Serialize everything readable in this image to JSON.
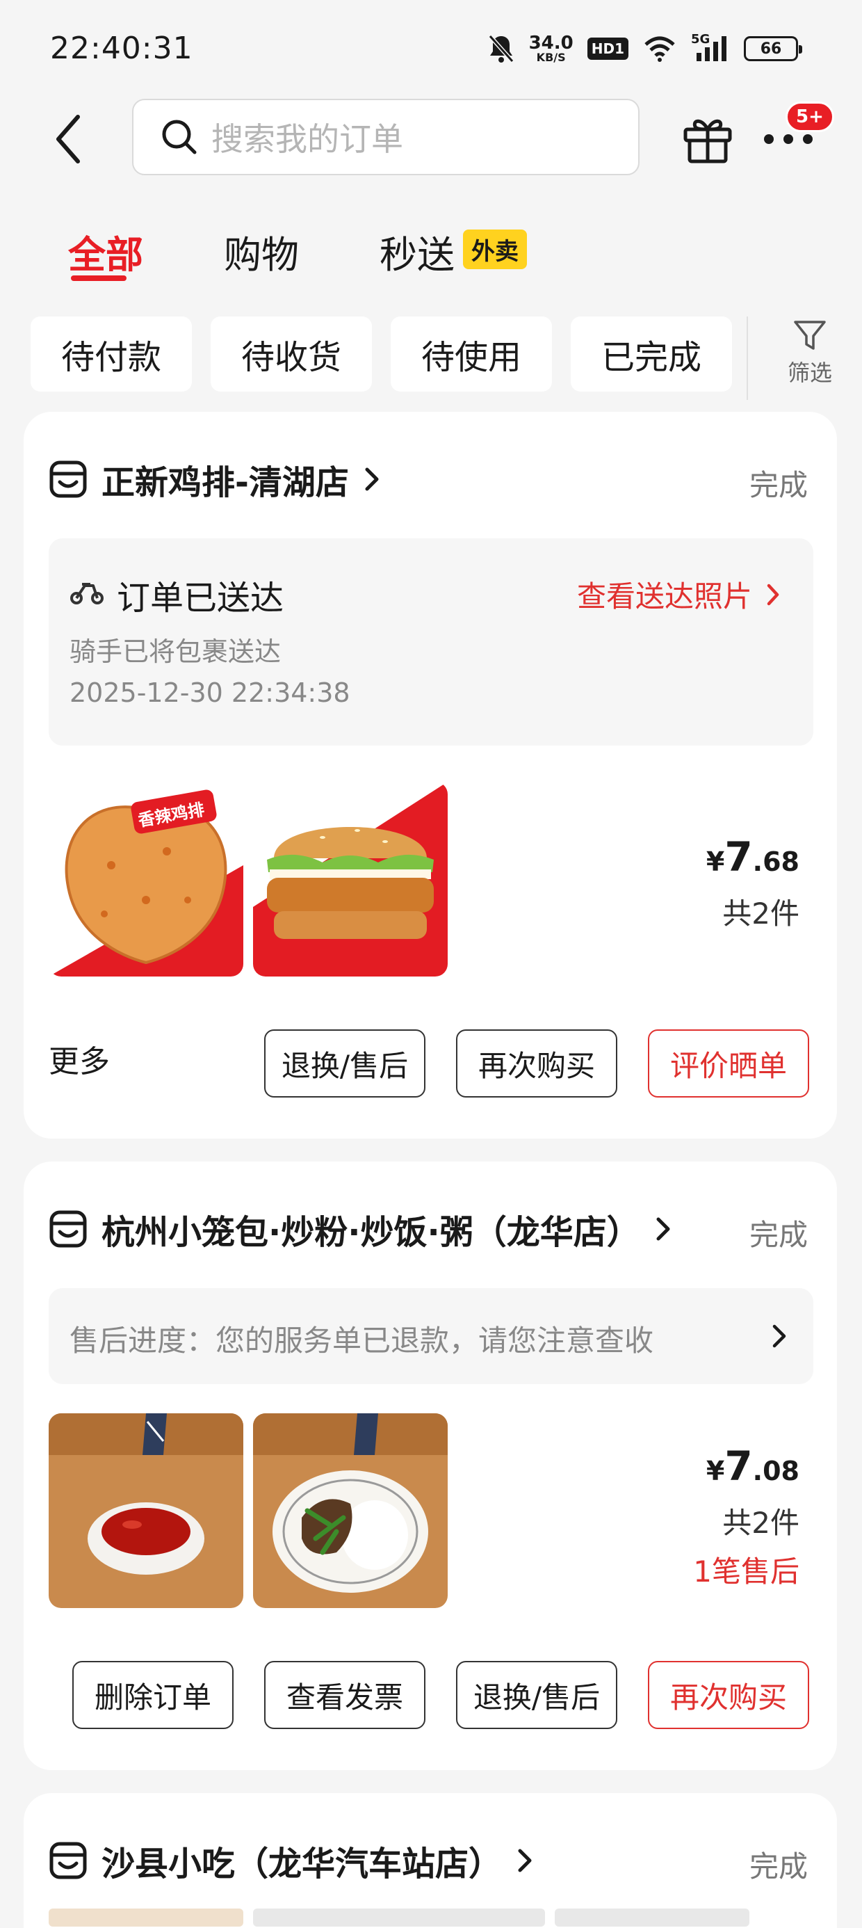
{
  "status_bar": {
    "time": "22:40:31",
    "net_speed": "34.0",
    "net_unit": "KB/S",
    "hd_label": "HD1",
    "signal_label": "5G",
    "battery": "66"
  },
  "header": {
    "search_placeholder": "搜索我的订单",
    "badge": "5+"
  },
  "tabs": [
    {
      "label": "全部",
      "active": true
    },
    {
      "label": "购物",
      "active": false
    },
    {
      "label": "秒送",
      "active": false,
      "tag": "外卖"
    }
  ],
  "filters": {
    "chips": [
      "待付款",
      "待收货",
      "待使用",
      "已完成"
    ],
    "filter_label": "筛选"
  },
  "orders": [
    {
      "shop_name": "正新鸡排-清湖店",
      "status": "完成",
      "delivery": {
        "title": "订单已送达",
        "photo_link": "查看送达照片",
        "sub": "骑手已将包裹送达",
        "time": "2025-12-30 22:34:38"
      },
      "img_tag": "香辣鸡排",
      "price_currency": "¥",
      "price_int": "7",
      "price_dec": ".68",
      "count": "共2件",
      "more": "更多",
      "buttons": [
        "退换/售后",
        "再次购买",
        "评价晒单"
      ]
    },
    {
      "shop_name": "杭州小笼包·炒粉·炒饭·粥（龙华店）",
      "status": "完成",
      "aftersale_progress": "售后进度：您的服务单已退款，请您注意查收",
      "price_currency": "¥",
      "price_int": "7",
      "price_dec": ".08",
      "count": "共2件",
      "aftersale_count": "1笔售后",
      "buttons": [
        "删除订单",
        "查看发票",
        "退换/售后",
        "再次购买"
      ]
    },
    {
      "shop_name": "沙县小吃（龙华汽车站店）",
      "status": "完成"
    }
  ],
  "colors": {
    "accent": "#e81e25",
    "link_red": "#e0312f",
    "tag_yellow": "#ffd21f",
    "background": "#f5f5f5"
  }
}
